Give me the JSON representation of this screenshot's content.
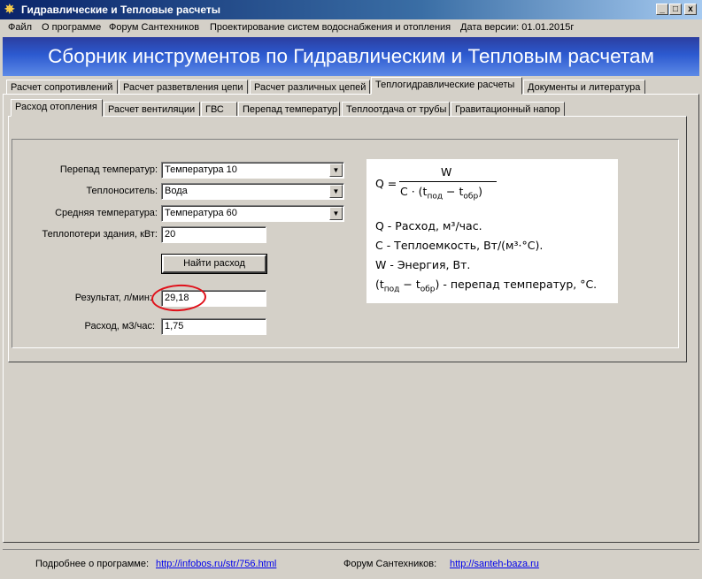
{
  "window": {
    "title": "Гидравлические и Тепловые расчеты",
    "minimize": "_",
    "maximize": "□",
    "close": "x"
  },
  "menu": [
    "Файл",
    "О программе",
    "Форум Сантехников",
    "Проектирование систем водоснабжения и отопления",
    "Дата версии: 01.01.2015г"
  ],
  "banner": "Сборник инструментов по Гидравлическим и Тепловым расчетам",
  "main_tabs": [
    "Расчет сопротивлений",
    "Расчет разветвления цепи",
    "Расчет различных цепей",
    "Теплогидравлические расчеты",
    "Документы и литература"
  ],
  "main_tab_active": 3,
  "sub_tabs": [
    "Расход отопления",
    "Расчет вентиляции",
    "ГВС",
    "Перепад температур",
    "Теплоотдача от трубы",
    "Гравитационный напор"
  ],
  "sub_tab_active": 0,
  "form": {
    "temp_diff_label": "Перепад температур:",
    "temp_diff_value": "Температура 10",
    "coolant_label": "Теплоноситель:",
    "coolant_value": "Вода",
    "avg_temp_label": "Средняя температура:",
    "avg_temp_value": "Температура 60",
    "heat_loss_label": "Теплопотери здания, кВт:",
    "heat_loss_value": "20",
    "find_button": "Найти расход",
    "result_label": "Результат, л/мин:",
    "result_value": "29,18",
    "flow_label": "Расход, м3/час:",
    "flow_value": "1,75"
  },
  "formula": {
    "lhs": "Q =",
    "numerator": "W",
    "denominator_prefix": "C · (t",
    "sub_supply": "под",
    "minus": " − t",
    "sub_return": "обр",
    "close_paren": ")",
    "legend_q": "Q - Расход, м³/час.",
    "legend_c": "C - Теплоемкость, Вт/(м³·°С).",
    "legend_w": "W - Энергия, Вт.",
    "legend_dt_open": "(t",
    "legend_dt_sub1": "под",
    "legend_dt_mid": " − t",
    "legend_dt_sub2": "обр",
    "legend_dt_tail": ") - перепад температур, °С."
  },
  "footer": {
    "about_label": "Подробнее о программе:",
    "about_link": "http://infobos.ru/str/756.html",
    "forum_label": "Форум Сантехников:",
    "forum_link": "http://santeh-baza.ru"
  }
}
